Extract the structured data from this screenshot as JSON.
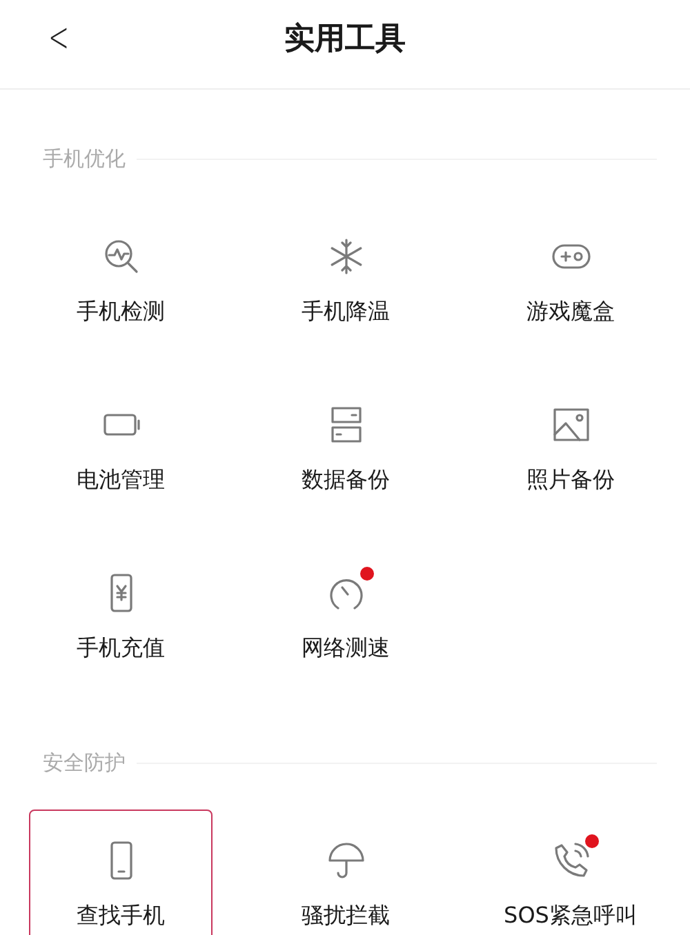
{
  "header": {
    "back": "<",
    "title": "实用工具"
  },
  "sections": [
    {
      "title": "手机优化",
      "items": [
        {
          "kind": "scan",
          "label": "手机检测",
          "badge": false,
          "selected": false
        },
        {
          "kind": "snow",
          "label": "手机降温",
          "badge": false,
          "selected": false
        },
        {
          "kind": "game",
          "label": "游戏魔盒",
          "badge": false,
          "selected": false
        },
        {
          "kind": "battery",
          "label": "电池管理",
          "badge": false,
          "selected": false
        },
        {
          "kind": "storage",
          "label": "数据备份",
          "badge": false,
          "selected": false
        },
        {
          "kind": "photo",
          "label": "照片备份",
          "badge": false,
          "selected": false
        },
        {
          "kind": "topup",
          "label": "手机充值",
          "badge": false,
          "selected": false
        },
        {
          "kind": "speed",
          "label": "网络测速",
          "badge": true,
          "selected": false
        }
      ]
    },
    {
      "title": "安全防护",
      "items": [
        {
          "kind": "phone",
          "label": "查找手机",
          "badge": false,
          "selected": true
        },
        {
          "kind": "umbrella",
          "label": "骚扰拦截",
          "badge": false,
          "selected": false
        },
        {
          "kind": "call",
          "label": "SOS紧急呼叫",
          "badge": true,
          "selected": false
        }
      ]
    }
  ]
}
